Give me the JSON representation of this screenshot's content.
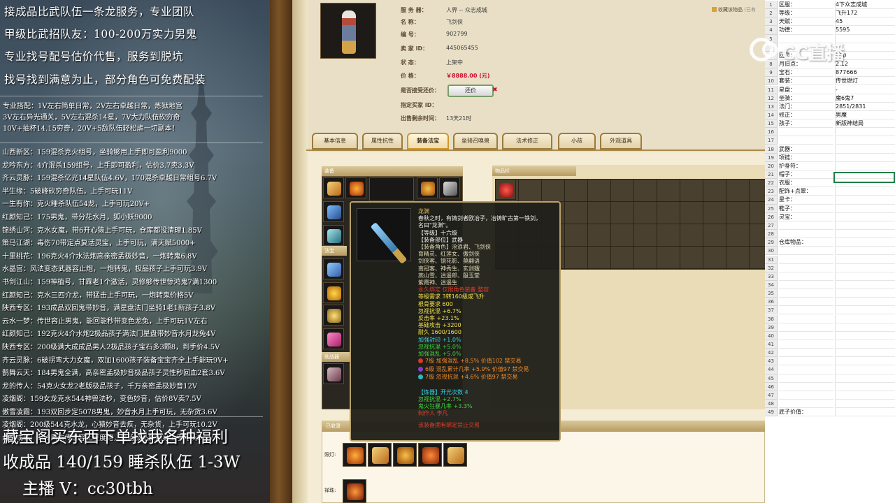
{
  "left_panel": {
    "promo_lines": [
      "接成品比武队伍一条龙服务，专业团队",
      "甲级比武招队友：100-200万实力男鬼",
      "专业找号配号估价代售，服务到脱坑",
      "找号找到满意为止，部分角色可免费配装"
    ],
    "combo_lines": [
      "专业搭配：1V左右简单日常，2V左右卓越日常，炼狱地宫",
      "3V左右异光通关，5V左右混杀14星，7V大力队伍砍穷奇",
      "10V+抽杯14.15穷奇，20V+5敌队伍轻松虐一切副本！"
    ],
    "listings": [
      "山西新区：159混杀克火组号，坐骑够用上手即可盈利9000",
      "龙吟东方：4介混杀159组号，上手即可盈利，估价3.7卖3.3V",
      "齐云灵脉：159混杀亿光14星队伍4.6V，170混杀卓越日常组号6.7V",
      "半生缘：5破峰砍穷奇队伍，上手可玩11V",
      "一生有你：克火睡杀队伍54龙，上手可玩20V+",
      "红颜知己：175男鬼，带分花水月，狐小妖9000",
      "锦绣山河：克水女魔，带6开心猿上手可玩，仓库都没清理1.85V",
      "策马江湖：毒伤70带定点复活灵宝，上手可玩，满天赋5000+",
      "十里桃花：196克火4介水法炮高亲密孟极妙音，一炮转鬼6.8V",
      "水晶宫：风法变态武器容止炮，一炮转鬼，极品孩子上手可玩3.9V",
      "书剑江山：159神植号，甘霖老1个激活，灵修够传世惊鸿鬼7满1300",
      "红颜知己：克水三四介龙，带猛击上手可玩，一炮转鬼价格5V",
      "陕西专区：193成品双回鬼带妙音，满星盘法门坐骑1老1新孩子3.8V",
      "云水一梦：传世容止男鬼，能回能秒带变色龙兔，上手可玩1V左右",
      "红颜知己：192克火4介水炮2极品孩子满法门星盘带妙音水月龙兔4V",
      "陕西专区：200级满大成成品男人2极品孩子宝石多3颗8，到手价4.5V",
      "齐云灵脉：6破拐弯大力女魔，双加1600孩子装备宝宝齐全上手能玩9V+",
      "鹊舞云天：184男鬼全满，高亲密孟极妙音极品孩子灵性秒回血2套3.6V",
      "龙的传人：54克火女龙2老版极品孩子，千万亲密孟极妙音12V",
      "凌烟阁：159女龙克水544神兽法秒，变色妙音，估价8V卖7.5V",
      "傲雪凌霜：193双回步定5078男鬼，妙音水月上手可玩，无杂货3.6V",
      "凌烟阁：200级544克水龙，心猿妙音去疾，无杂货，上手可玩10.2V",
      "众志成城：180风法传世容止程度炮，带孟极品质隐身上手可玩2.5V"
    ],
    "bottom_lines": [
      "藏宝阁买东西下单找我各种福利",
      "收成品 140/159 睡杀队伍 1-3W",
      "主播 V：cc30tbh"
    ]
  },
  "listing_info": {
    "favorite_link": "收藏该物品",
    "fav_suffix": "(已有",
    "rows": [
      {
        "label": "服  务  器：",
        "value": "人界 -- 众志成城"
      },
      {
        "label": "名       称：",
        "value": "飞剑侠"
      },
      {
        "label": "编       号：",
        "value": "902799"
      },
      {
        "label": "卖  家  ID：",
        "value": "445065455"
      },
      {
        "label": "状       态：",
        "value": "上架中"
      },
      {
        "label": "价       格：",
        "value": "￥8888.00 (元)"
      },
      {
        "label": "是否接受还价：",
        "value": ""
      },
      {
        "label": "指定买家 ID：",
        "value": ""
      },
      {
        "label": "出售剩余时间：",
        "value": "13天21时"
      }
    ],
    "counter_offer_button": "还价",
    "counter_x": "✖"
  },
  "tabs": [
    {
      "label": "基本信息",
      "active": false
    },
    {
      "label": "属性抗性",
      "active": false
    },
    {
      "label": "装备法宝",
      "active": true
    },
    {
      "label": "坐骑召唤兽",
      "active": false
    },
    {
      "label": "法术修正",
      "active": false
    },
    {
      "label": "小孩",
      "active": false
    },
    {
      "label": "外观道具",
      "active": false
    }
  ],
  "panels": {
    "equip_head": "装备",
    "inventory_head": "物品栏",
    "treasure_head": "法宝",
    "mount_head": "助战器",
    "collected_head": "已收录",
    "lamp_label": "照灯:",
    "beads_label": "禅珠:"
  },
  "tooltip": {
    "name": "龙渊",
    "desc_lines": [
      "春秋之时，有铸剑者欧冶子，冶铸旷古第一铁剑，",
      "名曰\"龙渊\"。"
    ],
    "level": "【等级】十六级",
    "slot": "【装备部位】武器",
    "roles_lines": [
      "【装备角色】沧浪君、飞剑侠",
      "育精灵、红莲女、傲剑侠",
      "剑侠客、镜花影、莫翩语",
      "南冠客、神秀生、玄剑娥",
      "燕山雪、逍遥郎、殷玉堂",
      "紫霞神、逍遥生"
    ],
    "soulbound": "永久绑定 仅限角色装备 整容",
    "req_lines": [
      "等级需求 3转160级或飞升",
      "根骨要求 600"
    ],
    "stats": [
      "忽视抗混 +6.7%",
      "反击率 +23.1%",
      "基础攻击 +3200",
      "耐久 1600/1600"
    ],
    "enhance": [
      "加强封印 +1.0%",
      "忽视抗混 +5.0%",
      "加强混乱 +5.0%"
    ],
    "gems": [
      {
        "text": "7级 加强混乱 +8.5% 价值102 禁交易",
        "color": "#d43a2a"
      },
      {
        "text": "6级 混乱累计几率 +5.9% 价值97 禁交易",
        "color": "#8a3ad4"
      },
      {
        "text": "7级 忽视抗混 +4.6% 价值97 禁交易",
        "color": "#2ab8c8"
      }
    ],
    "refine_title": "【炼器】开光次数 4",
    "refine_stats": [
      "忽视抗混 +2.7%",
      "鬼火狂暴几率 +3.3%"
    ],
    "maker": "制作人 李凡",
    "warning": "该装备拥有绑定禁止交易"
  },
  "sheet": {
    "rows": [
      {
        "n": "1",
        "a": "区服：",
        "b": "4下众志成城"
      },
      {
        "n": "2",
        "a": "等级：",
        "b": "飞升172"
      },
      {
        "n": "3",
        "a": "天赋：",
        "b": "45"
      },
      {
        "n": "4",
        "a": "功德：",
        "b": "5595"
      },
      {
        "n": "5",
        "a": "",
        "b": ""
      },
      {
        "n": "6",
        "a": "",
        "b": ""
      },
      {
        "n": "7",
        "a": "回灵：",
        "b": "150"
      },
      {
        "n": "8",
        "a": "月旧点：",
        "b": "2.12"
      },
      {
        "n": "9",
        "a": "宝石：",
        "b": "877666"
      },
      {
        "n": "10",
        "a": "套装：",
        "b": "传世燃灯"
      },
      {
        "n": "11",
        "a": "星盘：",
        "b": "-"
      },
      {
        "n": "12",
        "a": "坐骑：",
        "b": "魔6鬼7"
      },
      {
        "n": "13",
        "a": "法门：",
        "b": "2851/2831"
      },
      {
        "n": "14",
        "a": "修正：",
        "b": "男魔"
      },
      {
        "n": "15",
        "a": "孩子：",
        "b": "新版神结局"
      },
      {
        "n": "16",
        "a": "",
        "b": ""
      },
      {
        "n": "17",
        "a": "",
        "b": ""
      },
      {
        "n": "18",
        "a": "武器：",
        "b": ""
      },
      {
        "n": "19",
        "a": "项链：",
        "b": ""
      },
      {
        "n": "20",
        "a": "护身符：",
        "b": ""
      },
      {
        "n": "21",
        "a": "帽子：",
        "b": ""
      },
      {
        "n": "22",
        "a": "衣服：",
        "b": ""
      },
      {
        "n": "23",
        "a": "配饰+点翠：",
        "b": ""
      },
      {
        "n": "24",
        "a": "星卡：",
        "b": ""
      },
      {
        "n": "25",
        "a": "鞋子：",
        "b": ""
      },
      {
        "n": "26",
        "a": "灵宝：",
        "b": ""
      },
      {
        "n": "27",
        "a": "",
        "b": ""
      },
      {
        "n": "28",
        "a": "",
        "b": ""
      },
      {
        "n": "29",
        "a": "仓库物品：",
        "b": ""
      },
      {
        "n": "30",
        "a": "",
        "b": ""
      },
      {
        "n": "31",
        "a": "",
        "b": ""
      },
      {
        "n": "32",
        "a": "",
        "b": ""
      },
      {
        "n": "33",
        "a": "",
        "b": ""
      },
      {
        "n": "34",
        "a": "",
        "b": ""
      },
      {
        "n": "35",
        "a": "",
        "b": ""
      },
      {
        "n": "36",
        "a": "",
        "b": ""
      },
      {
        "n": "37",
        "a": "",
        "b": ""
      },
      {
        "n": "38",
        "a": "",
        "b": ""
      },
      {
        "n": "39",
        "a": "",
        "b": ""
      },
      {
        "n": "40",
        "a": "",
        "b": ""
      },
      {
        "n": "41",
        "a": "",
        "b": ""
      },
      {
        "n": "42",
        "a": "",
        "b": ""
      },
      {
        "n": "43",
        "a": "",
        "b": ""
      },
      {
        "n": "44",
        "a": "",
        "b": ""
      },
      {
        "n": "45",
        "a": "",
        "b": ""
      },
      {
        "n": "46",
        "a": "",
        "b": ""
      },
      {
        "n": "47",
        "a": "",
        "b": ""
      },
      {
        "n": "48",
        "a": "",
        "b": ""
      },
      {
        "n": "49",
        "a": "底子价值：",
        "b": ""
      }
    ]
  },
  "watermark": {
    "text": "CC直播"
  },
  "colors": {
    "price": "#c8102e",
    "sheet_select": "#1e7e45",
    "tab_active": "#d0962c"
  }
}
